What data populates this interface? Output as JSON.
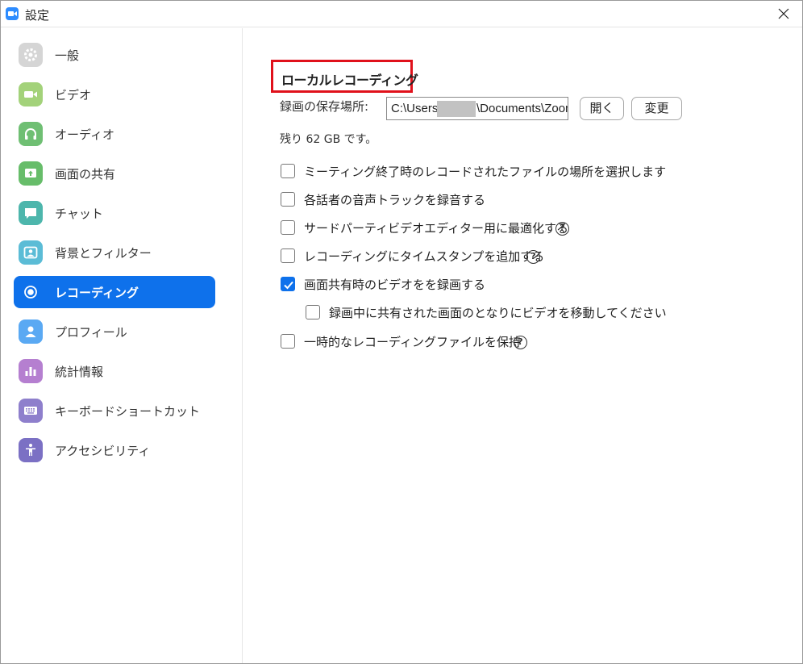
{
  "window": {
    "title": "設定",
    "close_symbol": "×"
  },
  "sidebar": {
    "items": [
      {
        "label": "一般",
        "icon": "gear-icon",
        "color": "#d5d5d5",
        "active": false
      },
      {
        "label": "ビデオ",
        "icon": "video-camera-icon",
        "color": "#a3d27a",
        "active": false
      },
      {
        "label": "オーディオ",
        "icon": "headphones-icon",
        "color": "#6fbf73",
        "active": false
      },
      {
        "label": "画面の共有",
        "icon": "share-screen-icon",
        "color": "#67bd6a",
        "active": false
      },
      {
        "label": "チャット",
        "icon": "chat-bubble-icon",
        "color": "#4db6ac",
        "active": false
      },
      {
        "label": "背景とフィルター",
        "icon": "background-person-icon",
        "color": "#5bbcd6",
        "active": false
      },
      {
        "label": "レコーディング",
        "icon": "record-icon",
        "color": "#0e71eb",
        "active": true
      },
      {
        "label": "プロフィール",
        "icon": "profile-person-icon",
        "color": "#5aa9f3",
        "active": false
      },
      {
        "label": "統計情報",
        "icon": "statistics-bar-icon",
        "color": "#b57fd0",
        "active": false
      },
      {
        "label": "キーボードショートカット",
        "icon": "keyboard-icon",
        "color": "#8e7fcc",
        "active": false
      },
      {
        "label": "アクセシビリティ",
        "icon": "accessibility-icon",
        "color": "#7b70c4",
        "active": false
      }
    ]
  },
  "main": {
    "section_title": "ローカルレコーディング",
    "save_location_label": "録画の保存場所:",
    "path_prefix": "C:\\Users\\",
    "path_suffix": "\\Documents\\Zoom",
    "open_button": "開く",
    "change_button": "変更",
    "remaining_space": "残り 62 GB です。",
    "options": [
      {
        "label": "ミーティング終了時のレコードされたファイルの場所を選択します",
        "checked": false,
        "help": false,
        "indent": false
      },
      {
        "label": "各話者の音声トラックを録音する",
        "checked": false,
        "help": false,
        "indent": false
      },
      {
        "label": "サードパーティビデオエディター用に最適化する",
        "checked": false,
        "help": true,
        "indent": false
      },
      {
        "label": "レコーディングにタイムスタンプを追加する",
        "checked": false,
        "help": true,
        "indent": false
      },
      {
        "label": "画面共有時のビデオをを録画する",
        "checked": true,
        "help": false,
        "indent": false
      },
      {
        "label": "録画中に共有された画面のとなりにビデオを移動してください",
        "checked": false,
        "help": false,
        "indent": true
      },
      {
        "label": "一時的なレコーディングファイルを保持",
        "checked": false,
        "help": true,
        "indent": false
      }
    ],
    "help_symbol": "?"
  },
  "colors": {
    "accent": "#0e71eb",
    "highlight_box": "#e0111b"
  }
}
